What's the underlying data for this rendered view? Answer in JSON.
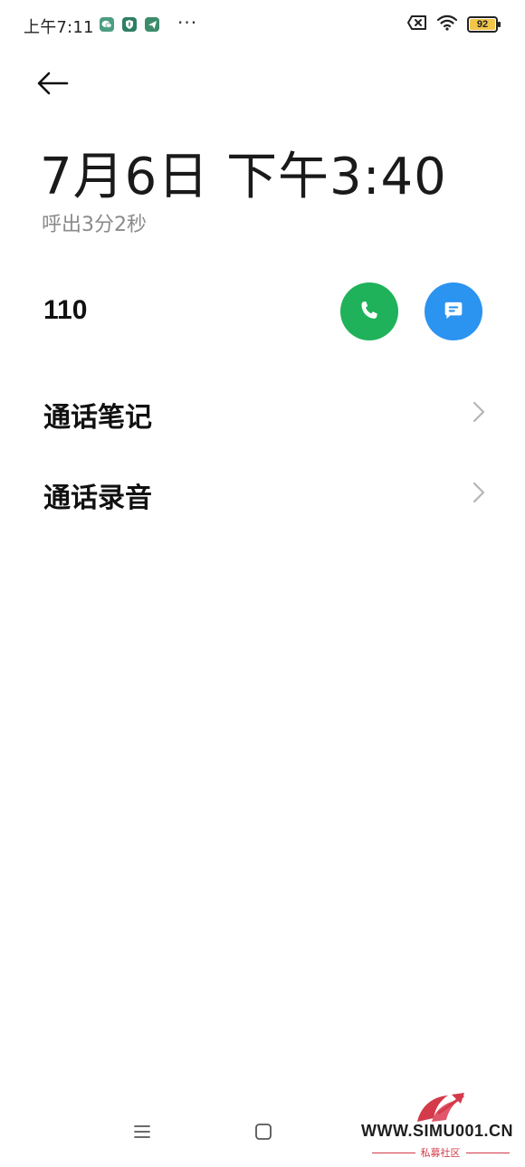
{
  "status_bar": {
    "time": "上午7:11",
    "more": "···",
    "battery_level": "92",
    "battery_fraction": 0.92,
    "icons": [
      "wechat-icon",
      "shield-app-icon",
      "send-app-icon",
      "sim-off-icon",
      "wifi-icon",
      "battery-icon"
    ]
  },
  "header": {
    "datetime": "7月6日 下午3:40",
    "duration": "呼出3分2秒"
  },
  "contact": {
    "number": "110",
    "call_color": "#1fb25a",
    "message_color": "#2b93f0"
  },
  "rows": [
    {
      "label": "通话笔记"
    },
    {
      "label": "通话录音"
    }
  ],
  "watermark": {
    "text": "WWW.SIMU001.CN",
    "subtitle": "私募社区",
    "color": "#d43a4a"
  }
}
